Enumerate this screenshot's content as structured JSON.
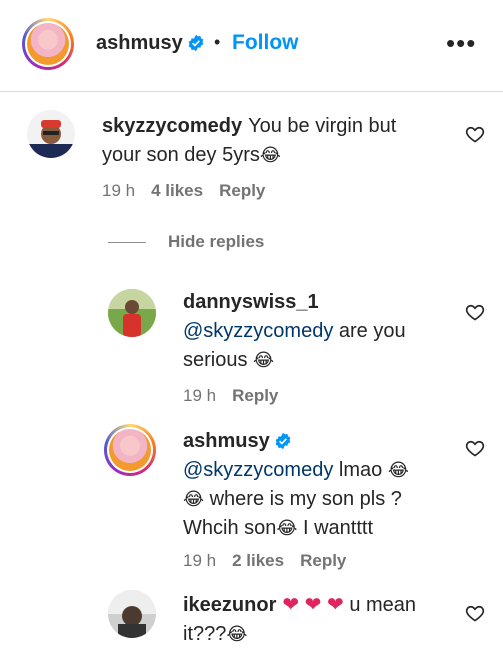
{
  "header": {
    "username": "ashmusy",
    "separator": "•",
    "follow_label": "Follow",
    "more_label": "•••"
  },
  "comments": [
    {
      "username": "skyzzycomedy",
      "text": "You be virgin but your son dey 5yrs",
      "emoji": "😂",
      "time": "19 h",
      "likes": "4 likes",
      "reply": "Reply"
    }
  ],
  "hide_replies_label": "Hide replies",
  "replies": [
    {
      "username": "dannyswiss_1",
      "mention": "@skyzzycomedy",
      "text": " are you serious ",
      "emoji": "😂",
      "time": "19 h",
      "reply": "Reply"
    },
    {
      "username": "ashmusy",
      "mention": "@skyzzycomedy",
      "text_1": " lmao ",
      "emoji": "😂",
      "text_2": " where is my son pls ?",
      "text_3": "Whcih son",
      "text_4": " I wantttt",
      "time": "19 h",
      "likes": "2 likes",
      "reply": "Reply"
    },
    {
      "username": "ikeezunor",
      "hearts": "❤ ❤ ❤",
      "text": "u mean",
      "text_2": "it???",
      "emoji": "😂"
    }
  ],
  "colors": {
    "link_blue": "#0095f6",
    "mention": "#00376b",
    "muted": "#737373",
    "heart_red": "#e0245e"
  }
}
